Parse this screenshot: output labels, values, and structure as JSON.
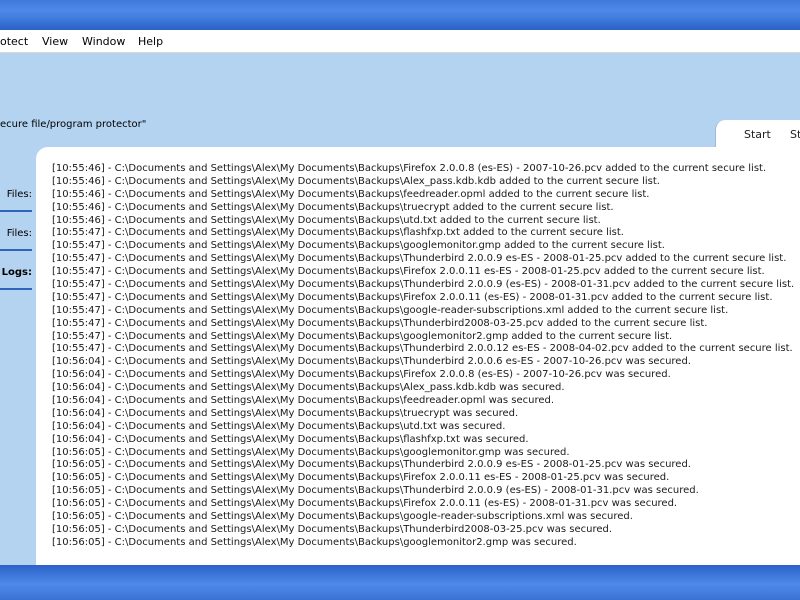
{
  "menu": {
    "items": [
      {
        "label": "otect"
      },
      {
        "label": "View"
      },
      {
        "label": "Window"
      },
      {
        "label": "Help"
      }
    ]
  },
  "header": {
    "subtitle": "ecure file/program protector\""
  },
  "tabs": [
    {
      "label": "Start"
    },
    {
      "label": "St"
    }
  ],
  "sidebar": {
    "labels": [
      "Files:",
      "Files:",
      "Logs:"
    ]
  },
  "log": {
    "lines": [
      "[10:55:46] - C:\\Documents and Settings\\Alex\\My Documents\\Backups\\Firefox 2.0.0.8 (es-ES) - 2007-10-26.pcv added to the current secure list.",
      "[10:55:46] - C:\\Documents and Settings\\Alex\\My Documents\\Backups\\Alex_pass.kdb.kdb added to the current secure list.",
      "[10:55:46] - C:\\Documents and Settings\\Alex\\My Documents\\Backups\\feedreader.opml added to the current secure list.",
      "[10:55:46] - C:\\Documents and Settings\\Alex\\My Documents\\Backups\\truecrypt added to the current secure list.",
      "[10:55:46] - C:\\Documents and Settings\\Alex\\My Documents\\Backups\\utd.txt added to the current secure list.",
      "[10:55:47] - C:\\Documents and Settings\\Alex\\My Documents\\Backups\\flashfxp.txt added to the current secure list.",
      "[10:55:47] - C:\\Documents and Settings\\Alex\\My Documents\\Backups\\googlemonitor.gmp added to the current secure list.",
      "[10:55:47] - C:\\Documents and Settings\\Alex\\My Documents\\Backups\\Thunderbird 2.0.0.9 es-ES - 2008-01-25.pcv added to the current secure list.",
      "[10:55:47] - C:\\Documents and Settings\\Alex\\My Documents\\Backups\\Firefox 2.0.0.11 es-ES - 2008-01-25.pcv added to the current secure list.",
      "[10:55:47] - C:\\Documents and Settings\\Alex\\My Documents\\Backups\\Thunderbird 2.0.0.9 (es-ES) - 2008-01-31.pcv added to the current secure list.",
      "[10:55:47] - C:\\Documents and Settings\\Alex\\My Documents\\Backups\\Firefox 2.0.0.11 (es-ES) - 2008-01-31.pcv added to the current secure list.",
      "[10:55:47] - C:\\Documents and Settings\\Alex\\My Documents\\Backups\\google-reader-subscriptions.xml added to the current secure list.",
      "[10:55:47] - C:\\Documents and Settings\\Alex\\My Documents\\Backups\\Thunderbird2008-03-25.pcv added to the current secure list.",
      "[10:55:47] - C:\\Documents and Settings\\Alex\\My Documents\\Backups\\googlemonitor2.gmp added to the current secure list.",
      "[10:55:47] - C:\\Documents and Settings\\Alex\\My Documents\\Backups\\Thunderbird 2.0.0.12 es-ES - 2008-04-02.pcv added to the current secure list.",
      "[10:56:04] - C:\\Documents and Settings\\Alex\\My Documents\\Backups\\Thunderbird 2.0.0.6 es-ES - 2007-10-26.pcv was secured.",
      "[10:56:04] - C:\\Documents and Settings\\Alex\\My Documents\\Backups\\Firefox 2.0.0.8 (es-ES) - 2007-10-26.pcv was secured.",
      "[10:56:04] - C:\\Documents and Settings\\Alex\\My Documents\\Backups\\Alex_pass.kdb.kdb was secured.",
      "[10:56:04] - C:\\Documents and Settings\\Alex\\My Documents\\Backups\\feedreader.opml was secured.",
      "[10:56:04] - C:\\Documents and Settings\\Alex\\My Documents\\Backups\\truecrypt was secured.",
      "[10:56:04] - C:\\Documents and Settings\\Alex\\My Documents\\Backups\\utd.txt was secured.",
      "[10:56:04] - C:\\Documents and Settings\\Alex\\My Documents\\Backups\\flashfxp.txt was secured.",
      "[10:56:05] - C:\\Documents and Settings\\Alex\\My Documents\\Backups\\googlemonitor.gmp was secured.",
      "[10:56:05] - C:\\Documents and Settings\\Alex\\My Documents\\Backups\\Thunderbird 2.0.0.9 es-ES - 2008-01-25.pcv was secured.",
      "[10:56:05] - C:\\Documents and Settings\\Alex\\My Documents\\Backups\\Firefox 2.0.0.11 es-ES - 2008-01-25.pcv was secured.",
      "[10:56:05] - C:\\Documents and Settings\\Alex\\My Documents\\Backups\\Thunderbird 2.0.0.9 (es-ES) - 2008-01-31.pcv was secured.",
      "[10:56:05] - C:\\Documents and Settings\\Alex\\My Documents\\Backups\\Firefox 2.0.0.11 (es-ES) - 2008-01-31.pcv was secured.",
      "[10:56:05] - C:\\Documents and Settings\\Alex\\My Documents\\Backups\\google-reader-subscriptions.xml was secured.",
      "[10:56:05] - C:\\Documents and Settings\\Alex\\My Documents\\Backups\\Thunderbird2008-03-25.pcv was secured.",
      "[10:56:05] - C:\\Documents and Settings\\Alex\\My Documents\\Backups\\googlemonitor2.gmp was secured."
    ]
  },
  "colors": {
    "frame_blue": "#2a62c9",
    "panel_bg": "#b4d3f1",
    "log_bg": "#ffffff",
    "separator": "#2f64bd"
  }
}
